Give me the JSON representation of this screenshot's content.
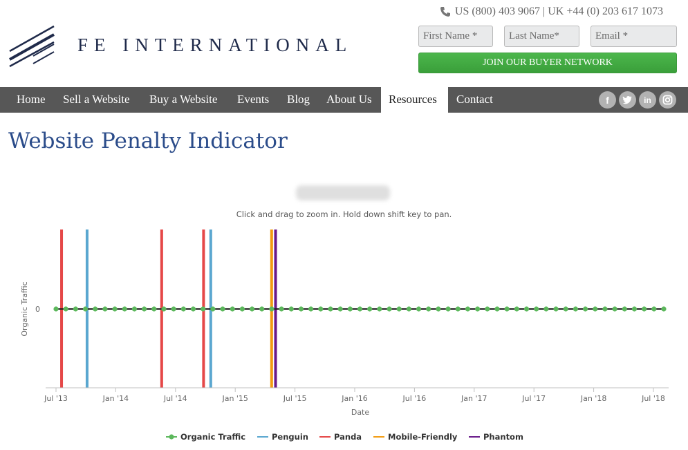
{
  "header": {
    "brand": "FE INTERNATIONAL",
    "phone": "US (800) 403 9067 | UK +44 (0) 203 617 1073",
    "form": {
      "first_name_placeholder": "First Name *",
      "last_name_placeholder": "Last Name*",
      "email_placeholder": "Email *"
    },
    "join_button": "JOIN OUR BUYER NETWORK"
  },
  "nav": {
    "items": [
      {
        "label": "Home"
      },
      {
        "label": "Sell a Website"
      },
      {
        "label": "Buy a Website"
      },
      {
        "label": "Events"
      },
      {
        "label": "Blog"
      },
      {
        "label": "About Us"
      },
      {
        "label": "Resources",
        "active": true
      },
      {
        "label": "Contact"
      }
    ],
    "social": [
      "facebook-icon",
      "twitter-icon",
      "linkedin-icon",
      "instagram-icon"
    ]
  },
  "page": {
    "title": "Website Penalty Indicator"
  },
  "chart_data": {
    "type": "line",
    "subtitle": "Click and drag to zoom in. Hold down shift key to pan.",
    "xlabel": "Date",
    "ylabel": "Organic Traffic",
    "x_ticks": [
      "Jul '13",
      "Jan '14",
      "Jul '14",
      "Jan '15",
      "Jul '15",
      "Jan '16",
      "Jul '16",
      "Jan '17",
      "Jul '17",
      "Jan '18",
      "Jul '18"
    ],
    "y_ticks": [
      "0"
    ],
    "grid": false,
    "legend_position": "bottom-center",
    "series": [
      {
        "name": "Organic Traffic",
        "color": "#5cb85c",
        "x_start": "2013-07",
        "x_end": "2018-07",
        "frequency": "monthly",
        "values": [
          0,
          0,
          0,
          0,
          0,
          0,
          0,
          0,
          0,
          0,
          0,
          0,
          0,
          0,
          0,
          0,
          0,
          0,
          0,
          0,
          0,
          0,
          0,
          0,
          0,
          0,
          0,
          0,
          0,
          0,
          0,
          0,
          0,
          0,
          0,
          0,
          0,
          0,
          0,
          0,
          0,
          0,
          0,
          0,
          0,
          0,
          0,
          0,
          0,
          0,
          0,
          0,
          0,
          0,
          0,
          0,
          0,
          0,
          0,
          0,
          0,
          0,
          0
        ]
      }
    ],
    "events": [
      {
        "name": "Penguin",
        "color": "#5aa7d0",
        "dates": [
          "2013-10-04",
          "2014-10-17"
        ]
      },
      {
        "name": "Panda",
        "color": "#e54848",
        "dates": [
          "2013-07-18",
          "2014-05-20",
          "2014-09-25"
        ]
      },
      {
        "name": "Mobile-Friendly",
        "color": "#f39c12",
        "dates": [
          "2015-04-21"
        ]
      },
      {
        "name": "Phantom",
        "color": "#6a1b8a",
        "dates": [
          "2015-05-03"
        ]
      }
    ]
  }
}
